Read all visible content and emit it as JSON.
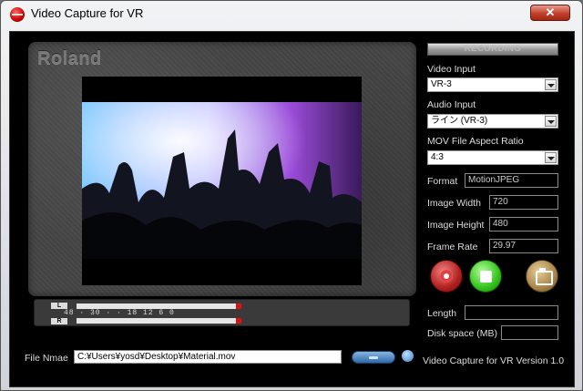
{
  "window": {
    "title": "Video Capture for VR",
    "close_label": "✕"
  },
  "preview": {
    "brand": "Roland"
  },
  "meter": {
    "left_label": "L",
    "right_label": "R",
    "scale": "48 · 30 · · 18 12 6 0"
  },
  "file": {
    "label": "File Nmae",
    "value": "C:¥Users¥yosd¥Desktop¥Material.mov"
  },
  "version": "Video Capture for VR Version 1.0",
  "status": {
    "recording_label": "RECORDING"
  },
  "video_input": {
    "label": "Video Input",
    "value": "VR-3"
  },
  "audio_input": {
    "label": "Audio Input",
    "value": "ライン (VR-3)"
  },
  "aspect": {
    "label": "MOV File Aspect Ratio",
    "value": "4:3"
  },
  "format": {
    "label": "Format",
    "value": "MotionJPEG"
  },
  "image_width": {
    "label": "Image Width",
    "value": "720"
  },
  "image_height": {
    "label": "Image Height",
    "value": "480"
  },
  "frame_rate": {
    "label": "Frame Rate",
    "value": "29.97"
  },
  "length": {
    "label": "Length",
    "value": ""
  },
  "disk_space": {
    "label": "Disk space (MB)",
    "value": ""
  },
  "icons": {
    "record": "record-icon",
    "stop": "stop-icon",
    "snapshot": "camera-icon",
    "browse": "folder-icon"
  },
  "colors": {
    "record": "#c42a2a",
    "stop": "#33c21d",
    "snapshot": "#a8844a",
    "peak": "#dd1111"
  }
}
